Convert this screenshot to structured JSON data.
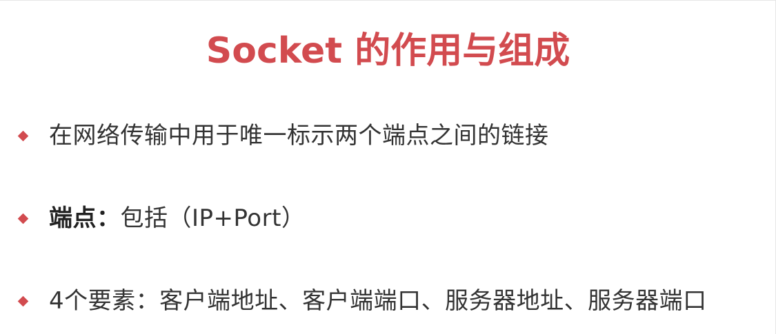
{
  "title": "Socket 的作用与组成",
  "bullets": [
    {
      "text": "在网络传输中用于唯一标示两个端点之间的链接"
    },
    {
      "label": "端点：",
      "text": "包括（IP+Port）"
    },
    {
      "text": "4个要素：客户端地址、客户端端口、服务器地址、服务器端口"
    }
  ],
  "colors": {
    "accent": "#d24b4f",
    "text": "#333333",
    "background": "#ffffff"
  },
  "icons": {
    "bullet": "diamond-bullet-icon"
  }
}
